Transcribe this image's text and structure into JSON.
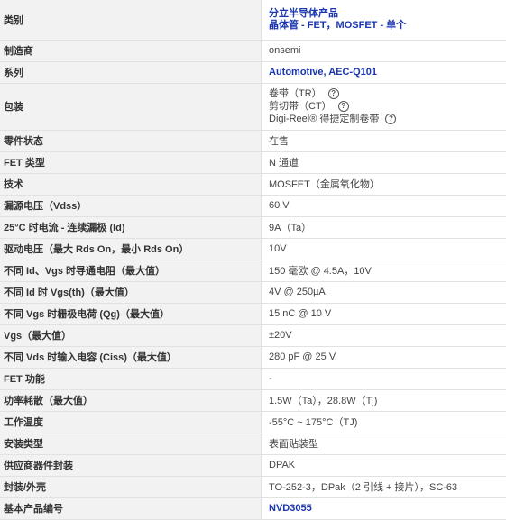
{
  "rows": [
    {
      "label": "类别",
      "lines": [
        "分立半导体产品",
        "晶体管 - FET，MOSFET - 单个"
      ]
    },
    {
      "label": "制造商",
      "value": "onsemi"
    },
    {
      "label": "系列",
      "value": "Automotive, AEC-Q101"
    },
    {
      "label": "包装",
      "packaging": [
        {
          "text": "卷带（TR）",
          "icon": "help-circle-icon"
        },
        {
          "text": "剪切带（CT）",
          "icon": "help-circle-icon"
        },
        {
          "text": "Digi-Reel® 得捷定制卷带",
          "icon": "help-circle-icon"
        }
      ]
    },
    {
      "label": "零件状态",
      "value": "在售"
    },
    {
      "label": "FET 类型",
      "value": "N 通道"
    },
    {
      "label": "技术",
      "value": "MOSFET（金属氧化物）"
    },
    {
      "label": "漏源电压（Vdss）",
      "value": "60 V"
    },
    {
      "label": "25°C 时电流 - 连续漏极 (Id)",
      "value": "9A（Ta）"
    },
    {
      "label": "驱动电压（最大 Rds On，最小 Rds On）",
      "value": "10V"
    },
    {
      "label": "不同 Id、Vgs 时导通电阻（最大值）",
      "value": "150 毫欧 @ 4.5A，10V"
    },
    {
      "label": "不同 Id 时 Vgs(th)（最大值）",
      "value": "4V @ 250µA"
    },
    {
      "label": "不同 Vgs 时栅极电荷 (Qg)（最大值）",
      "value": "15 nC @ 10 V"
    },
    {
      "label": "Vgs（最大值）",
      "value": "±20V"
    },
    {
      "label": "不同 Vds 时输入电容 (Ciss)（最大值）",
      "value": "280 pF @ 25 V"
    },
    {
      "label": "FET 功能",
      "value": "-"
    },
    {
      "label": "功率耗散（最大值）",
      "value": "1.5W（Ta），28.8W（Tj)"
    },
    {
      "label": "工作温度",
      "value": "-55°C ~ 175°C（TJ)"
    },
    {
      "label": "安装类型",
      "value": "表面贴装型"
    },
    {
      "label": "供应商器件封装",
      "value": "DPAK"
    },
    {
      "label": "封装/外壳",
      "value": "TO-252-3，DPak（2 引线 + 接片），SC-63"
    },
    {
      "label": "基本产品编号",
      "value": "NVD3055"
    }
  ],
  "colors": {
    "link": "#1a35b0",
    "label_bg": "#f2f2f2",
    "border": "#e2e2e2"
  }
}
